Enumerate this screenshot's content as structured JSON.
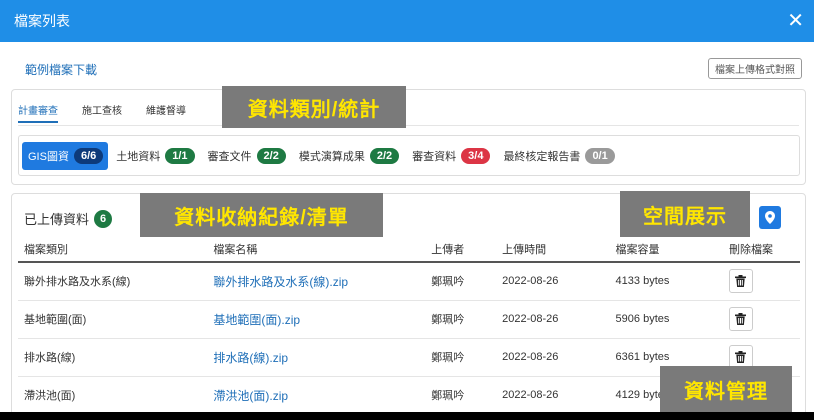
{
  "modal": {
    "title": "檔案列表",
    "close_glyph": "✕"
  },
  "sample_link": "範例檔案下載",
  "format_button": "檔案上傳格式對照",
  "tabs": [
    {
      "label": "計畫審查",
      "active": true
    },
    {
      "label": "施工查核",
      "active": false
    },
    {
      "label": "維護督導",
      "active": false
    }
  ],
  "categories": [
    {
      "label": "GIS圖資",
      "count": "6/6",
      "color": "#0d3a7a",
      "active": true
    },
    {
      "label": "土地資料",
      "count": "1/1",
      "color": "#1e7a43"
    },
    {
      "label": "審查文件",
      "count": "2/2",
      "color": "#1e7a43"
    },
    {
      "label": "模式演算成果",
      "count": "2/2",
      "color": "#1e7a43"
    },
    {
      "label": "審查資料",
      "count": "3/4",
      "color": "#dc3545"
    },
    {
      "label": "最終核定報告書",
      "count": "0/1",
      "color": "#9a9a9a"
    }
  ],
  "uploaded": {
    "title": "已上傳資料",
    "count": "6"
  },
  "table": {
    "headers": [
      "檔案類別",
      "檔案名稱",
      "上傳者",
      "上傳時間",
      "檔案容量",
      "刪除檔案"
    ],
    "rows": [
      {
        "category": "聯外排水路及水系(線)",
        "filename": "聯外排水路及水系(線).zip",
        "uploader": "鄭珮吟",
        "time": "2022-08-26",
        "size": "4133 bytes"
      },
      {
        "category": "基地範圍(面)",
        "filename": "基地範圍(面).zip",
        "uploader": "鄭珮吟",
        "time": "2022-08-26",
        "size": "5906 bytes"
      },
      {
        "category": "排水路(線)",
        "filename": "排水路(線).zip",
        "uploader": "鄭珮吟",
        "time": "2022-08-26",
        "size": "6361 bytes"
      },
      {
        "category": "滯洪池(面)",
        "filename": "滯洪池(面).zip",
        "uploader": "鄭珮吟",
        "time": "2022-08-26",
        "size": "4129 bytes"
      }
    ]
  },
  "overlays": {
    "category_stats": "資料類別/統計",
    "records": "資料收納紀錄/清單",
    "spatial": "空間展示",
    "management": "資料管理"
  },
  "icons": {
    "map": "map-marker-icon",
    "delete": "trash-icon",
    "close": "close-icon"
  },
  "colors": {
    "header": "#1f8ee7",
    "accent": "#1f7ae0",
    "link": "#1f6fb8",
    "overlay_bg": "#7a7a7a",
    "overlay_text": "#ffe600"
  }
}
